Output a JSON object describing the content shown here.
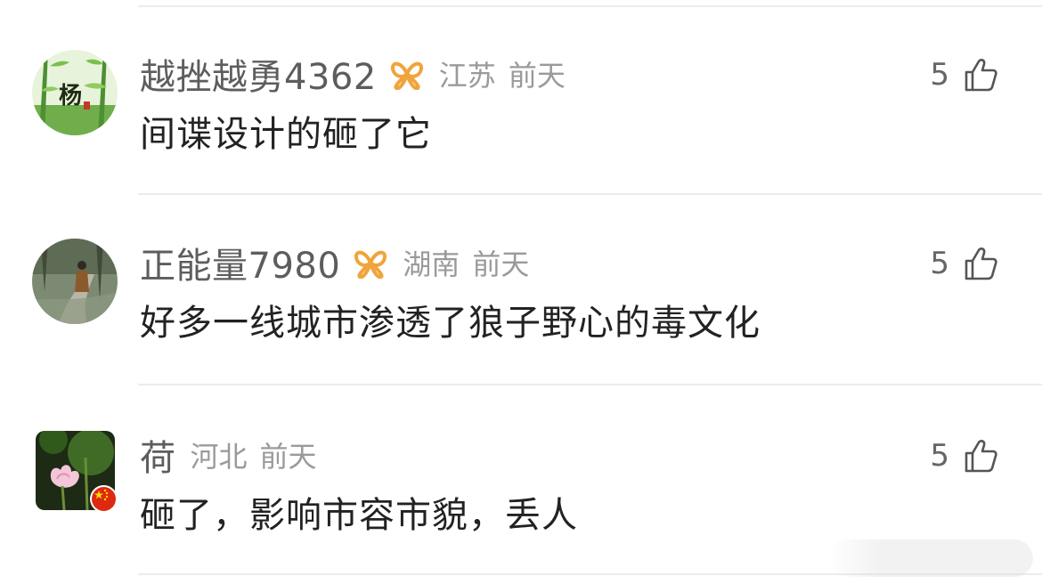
{
  "comments": [
    {
      "username": "越挫越勇4362",
      "vip_badge": "vip-butterfly-icon",
      "location": "江苏",
      "time": "前天",
      "likes": "5",
      "content": "间谍设计的砸了它"
    },
    {
      "username": "正能量7980",
      "vip_badge": "vip-butterfly-icon",
      "location": "湖南",
      "time": "前天",
      "likes": "5",
      "content": "好多一线城市渗透了狼子野心的毒文化"
    },
    {
      "username": "荷",
      "vip_badge": null,
      "location": "河北",
      "time": "前天",
      "likes": "5",
      "content": "砸了，影响市容市貌，丢人"
    }
  ],
  "colors": {
    "vip_badge": "#f0a43c",
    "username": "#5d5d5d",
    "meta": "#9a9a9a",
    "content": "#222222",
    "divider": "#ececec"
  },
  "icons": {
    "like": "thumbs-up-icon",
    "flag": "china-flag-icon"
  }
}
